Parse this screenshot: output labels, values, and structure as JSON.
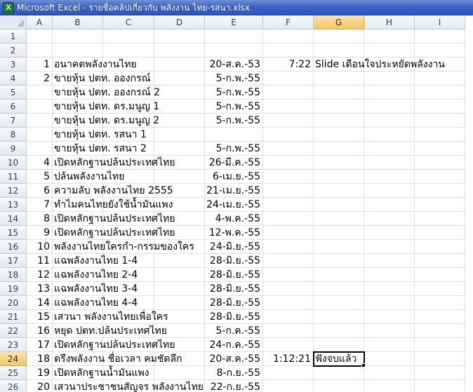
{
  "window": {
    "title": "Microsoft Excel - รายชื่อคลิปเกี่ยวกับ พลังงาน ไทย-รสนา.xlsx",
    "icon": "excel-icon",
    "icon_glyph": "X"
  },
  "sheet": {
    "columns": [
      "A",
      "B",
      "C",
      "D",
      "E",
      "F",
      "G",
      "H",
      "I"
    ],
    "active_column": "G",
    "active_row": 24,
    "selected_cell": "G24",
    "rows": [
      {
        "row": 1,
        "cells": {}
      },
      {
        "row": 2,
        "cells": {}
      },
      {
        "row": 3,
        "cells": {
          "A": "1",
          "B": "อนาคตพลังงานไทย",
          "E": "20-ส.ค.-53",
          "F": "7:22",
          "G": "Slide เตือนใจประหยัดพลังงาน"
        }
      },
      {
        "row": 4,
        "cells": {
          "A": "2",
          "B": "ขายหุ้น ปตท. อองกรณ์",
          "E": "5-ก.พ.-55"
        }
      },
      {
        "row": 5,
        "cells": {
          "B": "ขายหุ้น ปตท. อองกรณ์ 2",
          "E": "5-ก.พ.-55"
        }
      },
      {
        "row": 6,
        "cells": {
          "B": "ขายหุ้น ปตท. ดร.มนูญ 1",
          "E": "5-ก.พ.-55"
        }
      },
      {
        "row": 7,
        "cells": {
          "B": "ขายหุ้น ปตท. ดร.มนูญ 2",
          "E": "5-ก.พ.-55"
        }
      },
      {
        "row": 8,
        "cells": {
          "B": "ขายหุ้น ปตท. รสนา 1"
        }
      },
      {
        "row": 9,
        "cells": {
          "B": "ขายหุ้น ปตท. รสนา 2",
          "E": "5-ก.พ.-55"
        }
      },
      {
        "row": 10,
        "cells": {
          "A": "4",
          "B": "เปิดหลักฐานปล้นประเทศไทย",
          "E": "26-มี.ค.-55"
        }
      },
      {
        "row": 11,
        "cells": {
          "A": "5",
          "B": "ปล้นพลังงานไทย",
          "E": "6-เม.ย.-55"
        }
      },
      {
        "row": 12,
        "cells": {
          "A": "6",
          "B": "ความลับ พลังงานไทย 2555",
          "E": "21-เม.ย.-55"
        }
      },
      {
        "row": 13,
        "cells": {
          "A": "7",
          "B": "ทำไมคนไทยยังใช้น้ำมันแพง",
          "E": "24-เม.ย.-55"
        }
      },
      {
        "row": 14,
        "cells": {
          "A": "8",
          "B": "เปิดหลักฐานปล้นประเทศไทย",
          "E": "4-พ.ค.-55"
        }
      },
      {
        "row": 15,
        "cells": {
          "A": "9",
          "B": "เปิดหลักฐานปล้นประเทศไทย",
          "E": "12-พ.ค.-55"
        }
      },
      {
        "row": 16,
        "cells": {
          "A": "10",
          "B": "พลังงานไทยใครกำ-กรรมของใคร",
          "E": "24-มิ.ย.-55"
        }
      },
      {
        "row": 17,
        "cells": {
          "A": "11",
          "B": "แฉพลังงานไทย 1-4",
          "E": "28-มิ.ย.-55"
        }
      },
      {
        "row": 18,
        "cells": {
          "A": "12",
          "B": "แฉพลังงานไทย 2-4",
          "E": "28-มิ.ย.-55"
        }
      },
      {
        "row": 19,
        "cells": {
          "A": "13",
          "B": "แฉพลังงานไทย 3-4",
          "E": "28-มิ.ย.-55"
        }
      },
      {
        "row": 20,
        "cells": {
          "A": "14",
          "B": "แฉพลังงานไทย 4-4",
          "E": "28-มิ.ย.-55"
        }
      },
      {
        "row": 21,
        "cells": {
          "A": "15",
          "B": "เสวนา พลังงานไทยเพื่อใคร",
          "E": "28-มิ.ย.-55"
        }
      },
      {
        "row": 22,
        "cells": {
          "A": "16",
          "B": "หยุด ปตท.ปล้นประเทศไทย",
          "E": "5-ก.ค.-55"
        }
      },
      {
        "row": 23,
        "cells": {
          "A": "17",
          "B": "เปิดหลักฐานปล้นประเทศไทย",
          "E": "24-ก.ค.-55"
        }
      },
      {
        "row": 24,
        "cells": {
          "A": "18",
          "B": "ตรึงพลังงาน ชื่อเวลา คมชัดลึก",
          "E": "20-ส.ค.-55",
          "F": "1:12:21",
          "G": "ฟังจบแล้ว"
        }
      },
      {
        "row": 25,
        "cells": {
          "A": "19",
          "B": "เปิดหลักฐานน้ำมันแพง",
          "E": "8-ก.ย.-55"
        }
      },
      {
        "row": 26,
        "cells": {
          "A": "20",
          "B": "เสวนาประชาชนสัญจร พลังงานไทย",
          "E": "22-ก.ย.-55"
        }
      },
      {
        "row": 27,
        "cells": {}
      }
    ]
  }
}
